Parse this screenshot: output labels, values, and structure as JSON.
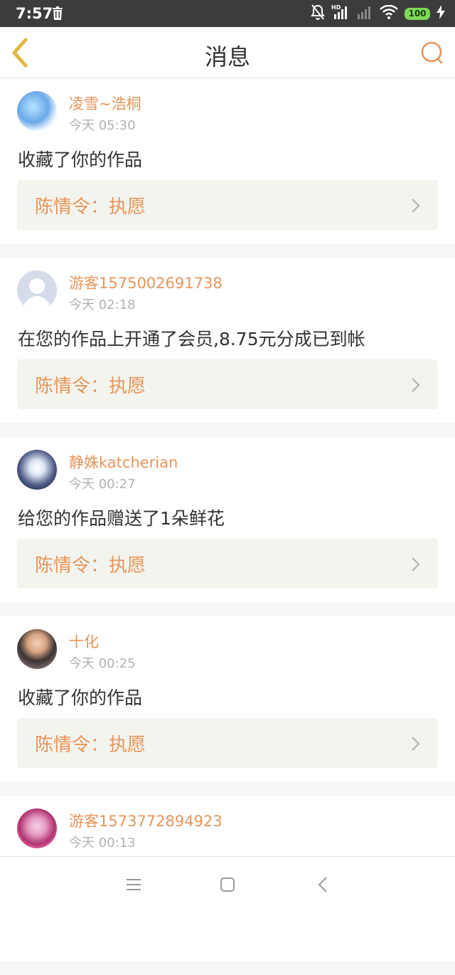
{
  "status_bar": {
    "time": "7:57",
    "battery": "100",
    "icons": [
      "trash-icon",
      "bell-off-icon",
      "hd-signal-icon",
      "signal-icon",
      "wifi-icon",
      "battery-icon",
      "charging-icon"
    ]
  },
  "header": {
    "title": "消息",
    "back_icon": "chevron-left-icon",
    "search_icon": "search-icon"
  },
  "colors": {
    "accent": "#e8955a",
    "back_arrow": "#e1b840",
    "card_bg": "#ffffff",
    "link_bg": "#f4f4ee",
    "status_bar": "#3c3c3c"
  },
  "messages": [
    {
      "user": "凌雪~浩桐",
      "time": "今天 05:30",
      "text": "收藏了你的作品",
      "work": "陈情令：执愿"
    },
    {
      "user": "游客1575002691738",
      "time": "今天 02:18",
      "text": "在您的作品上开通了会员,8.75元分成已到帐",
      "work": "陈情令：执愿"
    },
    {
      "user": "静姝katcherian",
      "time": "今天 00:27",
      "text": "给您的作品赠送了1朵鲜花",
      "work": "陈情令：执愿"
    },
    {
      "user": "十化",
      "time": "今天 00:25",
      "text": "收藏了你的作品",
      "work": "陈情令：执愿"
    },
    {
      "user": "游客1573772894923",
      "time": "今天 00:13",
      "text": "",
      "work": ""
    }
  ],
  "nav": {
    "icons": [
      "menu-icon",
      "home-square-icon",
      "back-triangle-icon"
    ]
  }
}
